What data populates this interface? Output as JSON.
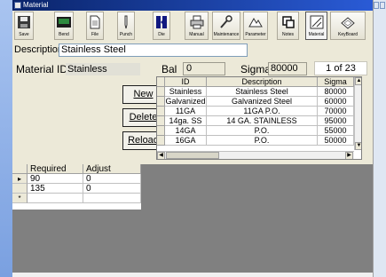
{
  "window": {
    "title": "Material"
  },
  "toolbar": {
    "buttons": [
      {
        "label": "Save",
        "icon": "floppy-disk-icon"
      },
      {
        "label": "Bend",
        "icon": "bend-machine-icon"
      },
      {
        "label": "File",
        "icon": "file-icon"
      },
      {
        "label": "Punch",
        "icon": "punch-icon"
      },
      {
        "label": "Die",
        "icon": "die-icon"
      },
      {
        "label": "Manual",
        "icon": "printer-icon"
      },
      {
        "label": "Maintenance",
        "icon": "wrench-icon"
      },
      {
        "label": "Parameter",
        "icon": "parameter-icon"
      },
      {
        "label": "Notes",
        "icon": "notes-icon"
      },
      {
        "label": "Material",
        "icon": "material-icon"
      },
      {
        "label": "KeyBoard",
        "icon": "keyboard-icon"
      }
    ]
  },
  "form": {
    "description_label": "Description",
    "description_value": "Stainless Steel",
    "material_id_label": "Material ID",
    "material_id_value": "Stainless",
    "bal_label": "Bal",
    "bal_value": "0",
    "sigma_label": "Sigma",
    "sigma_value": "80000",
    "record_count": "1 of  23"
  },
  "buttons": {
    "new": "New",
    "delete": "Delete",
    "reload": "Reload"
  },
  "materials_grid": {
    "columns": [
      "ID",
      "Description",
      "Sigma"
    ],
    "rows": [
      [
        "Stainless",
        "Stainless Steel",
        "80000"
      ],
      [
        "Galvanized",
        "Galvanized Steel",
        "60000"
      ],
      [
        "11GA",
        "11GA P.O.",
        "70000"
      ],
      [
        "14ga. SS",
        "14 GA. STAINLESS",
        "95000"
      ],
      [
        "14GA",
        "P.O.",
        "55000"
      ],
      [
        "16GA",
        "P.O.",
        "50000"
      ]
    ]
  },
  "adjust_grid": {
    "columns": [
      "Required",
      "Adjust"
    ],
    "rows": [
      [
        "90",
        "0"
      ],
      [
        "135",
        "0"
      ]
    ],
    "new_row_marker": "*",
    "current_row_marker": "▸"
  },
  "colors": {
    "window_bg": "#ece9d8",
    "titlebar": "#0a246a",
    "grey_area": "#808080"
  }
}
